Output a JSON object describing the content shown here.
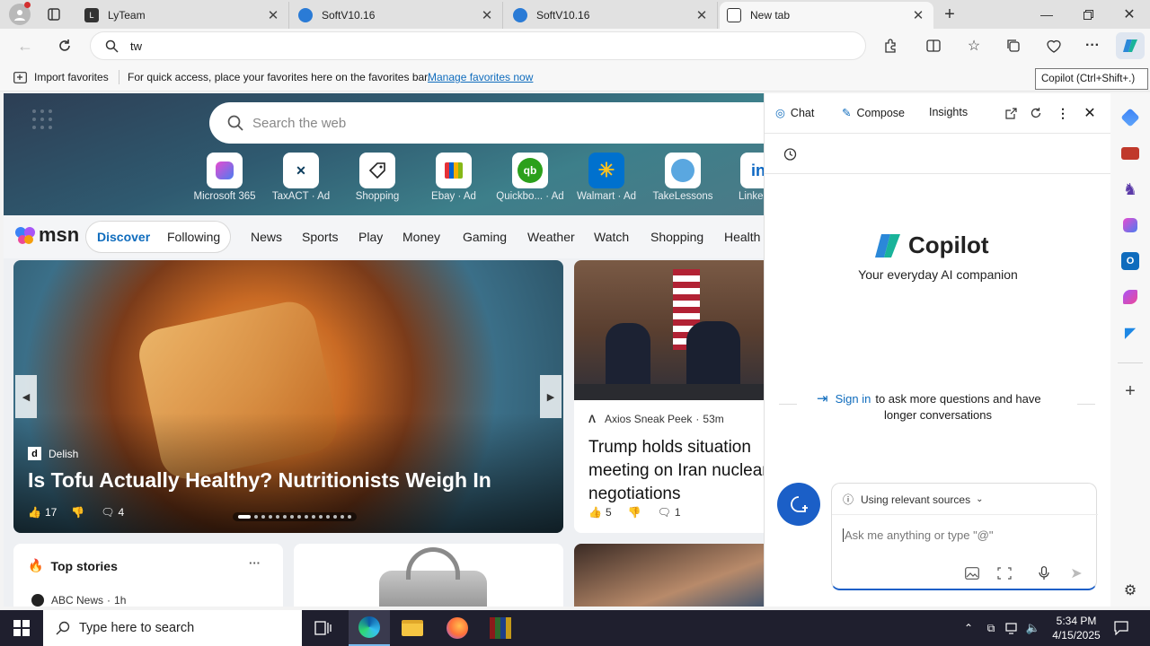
{
  "tabs": [
    {
      "title": "LyTeam"
    },
    {
      "title": "SoftV10.16"
    },
    {
      "title": "SoftV10.16"
    },
    {
      "title": "New tab"
    }
  ],
  "address": {
    "value": "tw"
  },
  "favorites_bar": {
    "import_label": "Import favorites",
    "message": "For quick access, place your favorites here on the favorites bar.",
    "manage_link": "Manage favorites now"
  },
  "tooltip": "Copilot (Ctrl+Shift+.)",
  "newtab": {
    "search_placeholder": "Search the web",
    "quick_links": [
      {
        "label": "Microsoft 365",
        "ad": ""
      },
      {
        "label": "TaxACT",
        "ad": "Ad"
      },
      {
        "label": "Shopping",
        "ad": ""
      },
      {
        "label": "Ebay",
        "ad": "Ad"
      },
      {
        "label": "Quickbo...",
        "ad": "Ad"
      },
      {
        "label": "Walmart",
        "ad": "Ad"
      },
      {
        "label": "TakeLessons",
        "ad": ""
      },
      {
        "label": "Linke",
        "ad": ""
      }
    ]
  },
  "msn": {
    "logo": "msn",
    "pill_tabs": [
      "Discover",
      "Following"
    ],
    "nav": [
      "News",
      "Sports",
      "Play",
      "Money",
      "Gaming",
      "Weather",
      "Watch",
      "Shopping",
      "Health"
    ]
  },
  "card_main": {
    "source": "Delish",
    "headline": "Is Tofu Actually Healthy? Nutritionists Weigh In",
    "likes": "17",
    "comments": "4"
  },
  "card_side": {
    "source": "Axios Sneak Peek",
    "time": "53m",
    "headline": "Trump holds situation meeting on Iran nuclear negotiations",
    "likes": "5",
    "comments": "1"
  },
  "top_stories": {
    "title": "Top stories",
    "first_source": "ABC News",
    "first_time": "1h"
  },
  "copilot": {
    "tabs": [
      "Chat",
      "Compose",
      "Insights"
    ],
    "brand": "Copilot",
    "tagline": "Your everyday AI companion",
    "signin_link": "Sign in",
    "signin_text_1": "to ask more questions and have",
    "signin_text_2": "longer conversations",
    "sources_label": "Using relevant sources",
    "input_placeholder": "Ask me anything or type \"@\""
  },
  "taskbar": {
    "search_placeholder": "Type here to search",
    "time": "5:34 PM",
    "date": "4/15/2025"
  },
  "colors": {
    "accent": "#0f6cbd",
    "link": "#0f6cbd",
    "taskbar": "#1f1f2e"
  }
}
